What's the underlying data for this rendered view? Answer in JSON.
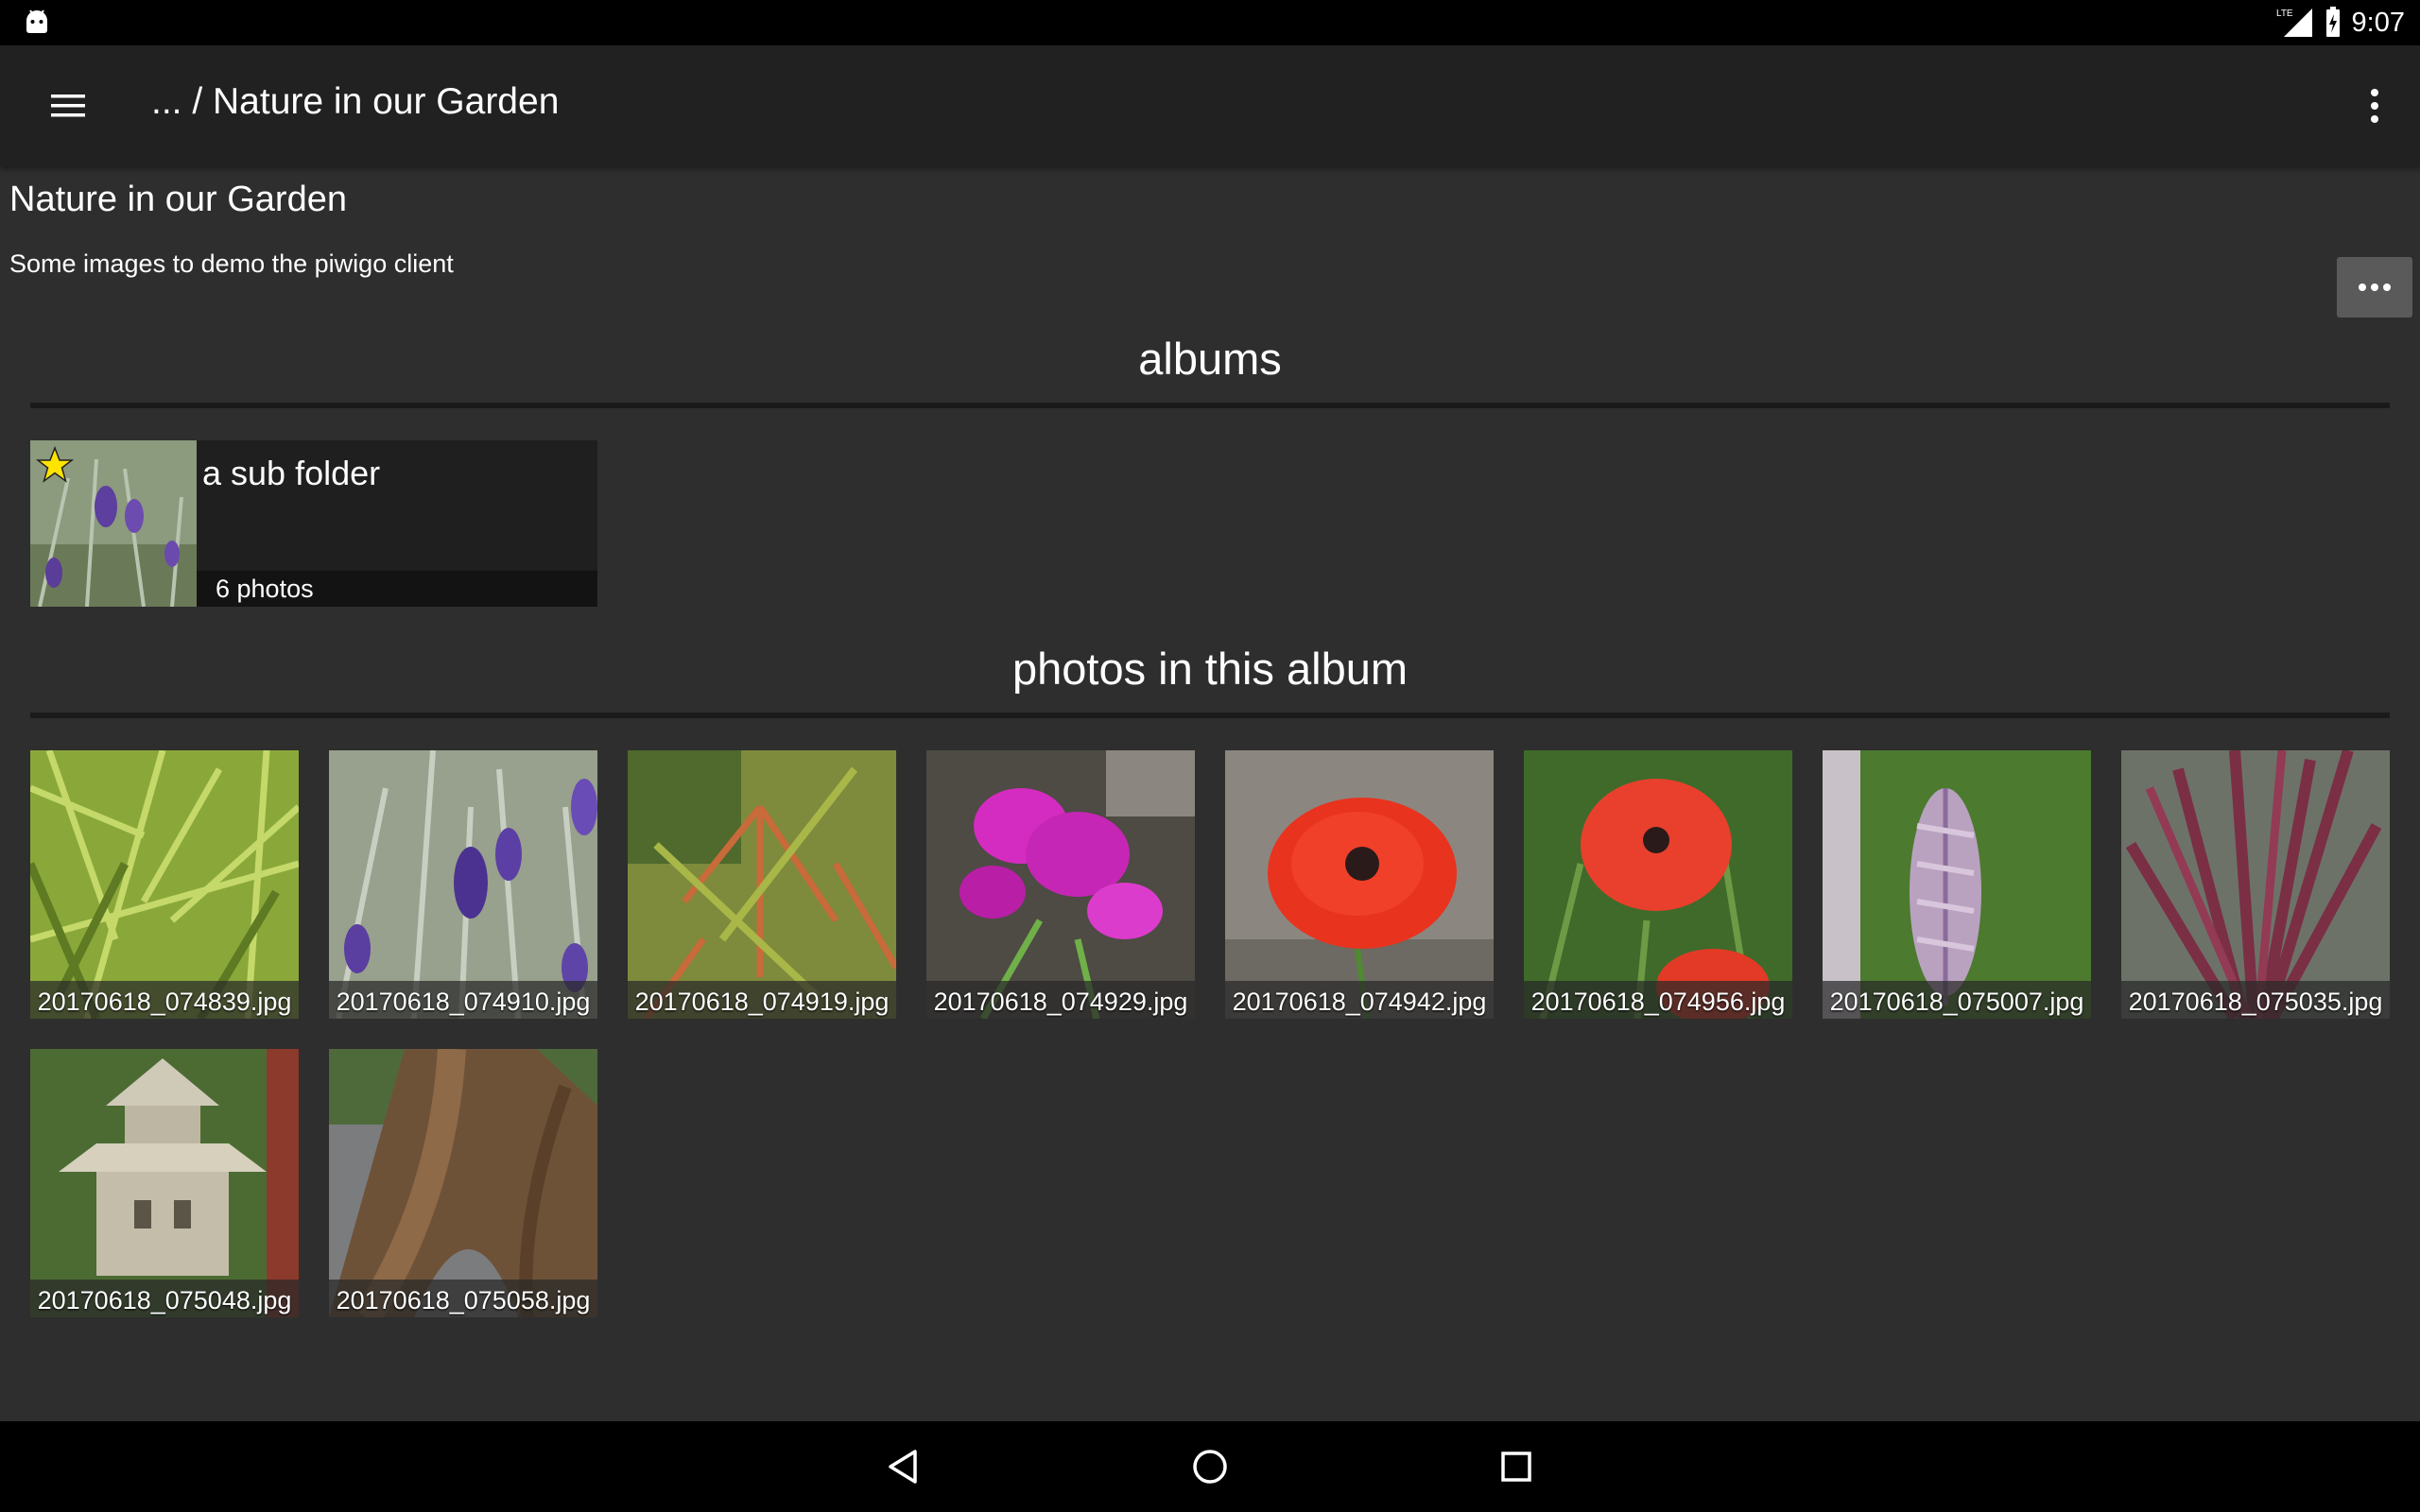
{
  "status_bar": {
    "time": "9:07",
    "network": "LTE",
    "icons": [
      "android-icon",
      "lte-signal-icon",
      "battery-charging-icon"
    ]
  },
  "toolbar": {
    "title": "... / Nature in our Garden",
    "menu_icon": "hamburger-menu-icon",
    "overflow_icon": "more-vert-icon"
  },
  "album": {
    "title": "Nature in our Garden",
    "description": "Some images to demo the piwigo client",
    "more_button_icon": "more-horiz-icon"
  },
  "sections": {
    "albums_heading": "albums",
    "photos_heading": "photos in this album"
  },
  "sub_albums": [
    {
      "name": "a sub folder",
      "count": "6 photos",
      "starred": true
    }
  ],
  "photos": [
    {
      "filename": "20170618_074839.jpg",
      "subject": "bamboo leaves"
    },
    {
      "filename": "20170618_074910.jpg",
      "subject": "lavender"
    },
    {
      "filename": "20170618_074919.jpg",
      "subject": "maple leaves"
    },
    {
      "filename": "20170618_074929.jpg",
      "subject": "pink sweet pea"
    },
    {
      "filename": "20170618_074942.jpg",
      "subject": "red poppy"
    },
    {
      "filename": "20170618_074956.jpg",
      "subject": "red poppies"
    },
    {
      "filename": "20170618_075007.jpg",
      "subject": "acanthus spike"
    },
    {
      "filename": "20170618_075035.jpg",
      "subject": "red cordyline leaves"
    },
    {
      "filename": "20170618_075048.jpg",
      "subject": "stone lantern"
    },
    {
      "filename": "20170618_075058.jpg",
      "subject": "tree trunk"
    }
  ],
  "nav_bar": {
    "icons": [
      "back-icon",
      "home-icon",
      "recents-icon"
    ]
  },
  "colors": {
    "background": "#2e2e2e",
    "toolbar": "#212121",
    "status_bar": "#000000",
    "card": "#1f1f1f",
    "button": "#5a5a5a"
  }
}
